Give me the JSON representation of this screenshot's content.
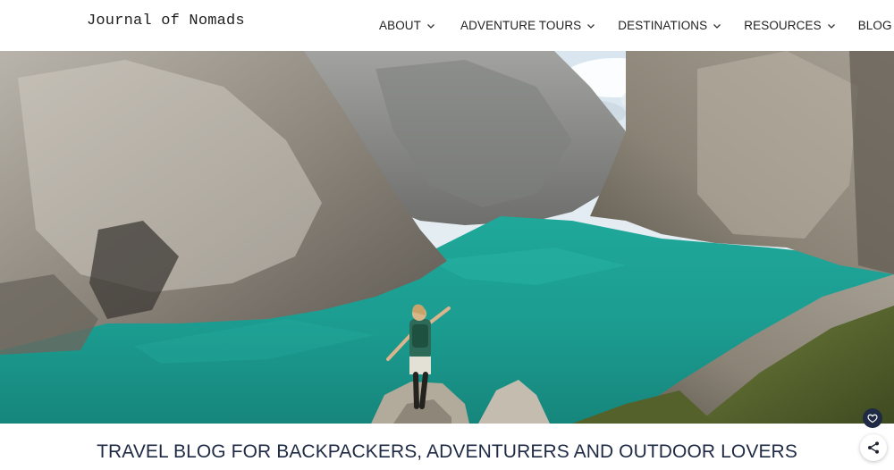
{
  "site": {
    "logo_text": "Journal of Nomads"
  },
  "nav": {
    "items": [
      {
        "label": "ABOUT",
        "has_dropdown": true
      },
      {
        "label": "ADVENTURE TOURS",
        "has_dropdown": true
      },
      {
        "label": "DESTINATIONS",
        "has_dropdown": true
      },
      {
        "label": "RESOURCES",
        "has_dropdown": true
      },
      {
        "label": "BLOG",
        "has_dropdown": false
      }
    ],
    "language_flag": "netherlands-flag-icon"
  },
  "hero": {
    "image": "mountain-lake-hiker-photo"
  },
  "tagline": "TRAVEL BLOG FOR BACKPACKERS, ADVENTURERS AND OUTDOOR LOVERS",
  "floating_buttons": {
    "heart_icon": "heart-icon",
    "share_icon": "share-icon"
  },
  "colors": {
    "accent": "#1f2a44",
    "flag_red": "#ae1c28",
    "flag_white": "#ffffff",
    "flag_blue": "#21468b"
  }
}
